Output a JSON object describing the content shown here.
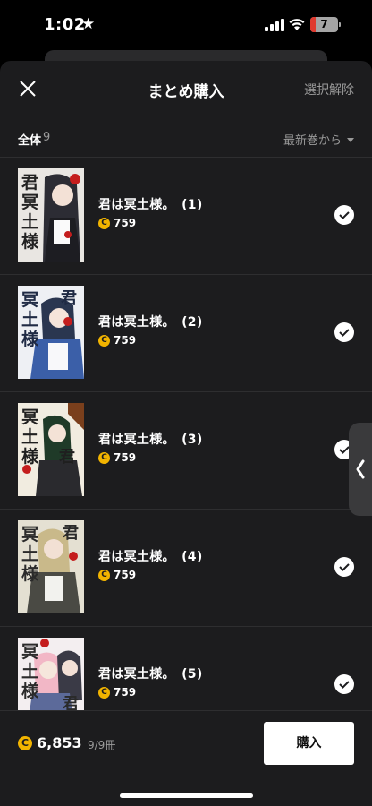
{
  "status_bar": {
    "time": "1:02",
    "star": "★",
    "battery": "7"
  },
  "header": {
    "close_icon": "close-icon",
    "title": "まとめ購入",
    "deselect_label": "選択解除"
  },
  "filter": {
    "all_label": "全体",
    "count": "9",
    "sort_label": "最新巻から"
  },
  "items": [
    {
      "title": "君は冥土様。　(1)",
      "price": "759",
      "selected": true
    },
    {
      "title": "君は冥土様。　(2)",
      "price": "759",
      "selected": true
    },
    {
      "title": "君は冥土様。　(3)",
      "price": "759",
      "selected": true
    },
    {
      "title": "君は冥土様。　(4)",
      "price": "759",
      "selected": true
    },
    {
      "title": "君は冥土様。　(5)",
      "price": "759",
      "selected": true
    }
  ],
  "footer": {
    "coin_symbol": "C",
    "total": "6,853",
    "volumes": "9/9冊",
    "buy_label": "購入"
  },
  "colors": {
    "background": "#1c1c1e",
    "coin": "#f2b400",
    "muted_text": "#9a9a9a"
  }
}
